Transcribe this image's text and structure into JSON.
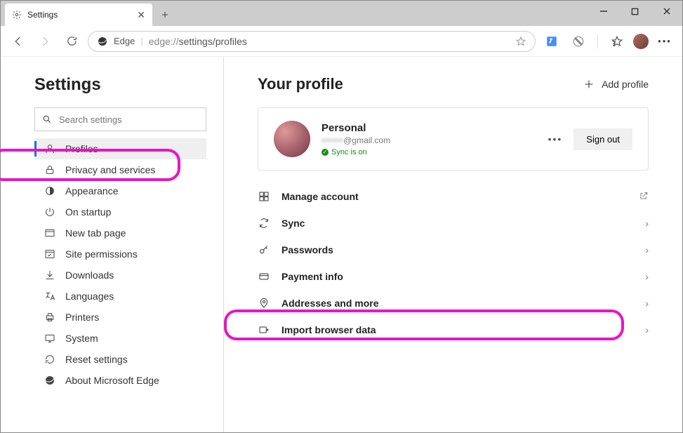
{
  "window": {
    "tab_title": "Settings"
  },
  "omnibox": {
    "prefix": "Edge",
    "url_dim": "edge://",
    "url_main": "settings/profiles"
  },
  "sidebar": {
    "title": "Settings",
    "search_placeholder": "Search settings",
    "items": [
      {
        "label": "Profiles"
      },
      {
        "label": "Privacy and services"
      },
      {
        "label": "Appearance"
      },
      {
        "label": "On startup"
      },
      {
        "label": "New tab page"
      },
      {
        "label": "Site permissions"
      },
      {
        "label": "Downloads"
      },
      {
        "label": "Languages"
      },
      {
        "label": "Printers"
      },
      {
        "label": "System"
      },
      {
        "label": "Reset settings"
      },
      {
        "label": "About Microsoft Edge"
      }
    ]
  },
  "content": {
    "heading": "Your profile",
    "add_profile": "Add profile",
    "profile": {
      "name": "Personal",
      "email_hidden": "••••••",
      "email_suffix": "@gmail.com",
      "sync_status": "Sync is on",
      "signout": "Sign out"
    },
    "items": [
      {
        "label": "Manage account",
        "action": "external"
      },
      {
        "label": "Sync",
        "action": "chevron"
      },
      {
        "label": "Passwords",
        "action": "chevron"
      },
      {
        "label": "Payment info",
        "action": "chevron"
      },
      {
        "label": "Addresses and more",
        "action": "chevron"
      },
      {
        "label": "Import browser data",
        "action": "chevron"
      }
    ]
  }
}
